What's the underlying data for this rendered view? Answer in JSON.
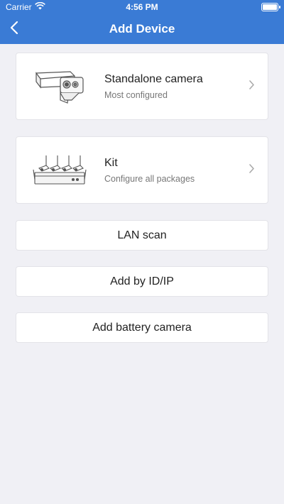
{
  "status": {
    "carrier": "Carrier",
    "time": "4:56 PM"
  },
  "nav": {
    "title": "Add Device",
    "back_icon": "chevron-left-icon"
  },
  "cards": [
    {
      "title": "Standalone camera",
      "subtitle": "Most configured",
      "icon": "bullet-camera-icon"
    },
    {
      "title": "Kit",
      "subtitle": "Configure all packages",
      "icon": "nvr-kit-icon"
    }
  ],
  "buttons": {
    "lan_scan": "LAN scan",
    "add_by_id": "Add by ID/IP",
    "add_battery": "Add battery camera"
  },
  "colors": {
    "header": "#3a7bd5",
    "background": "#f0f0f5"
  }
}
